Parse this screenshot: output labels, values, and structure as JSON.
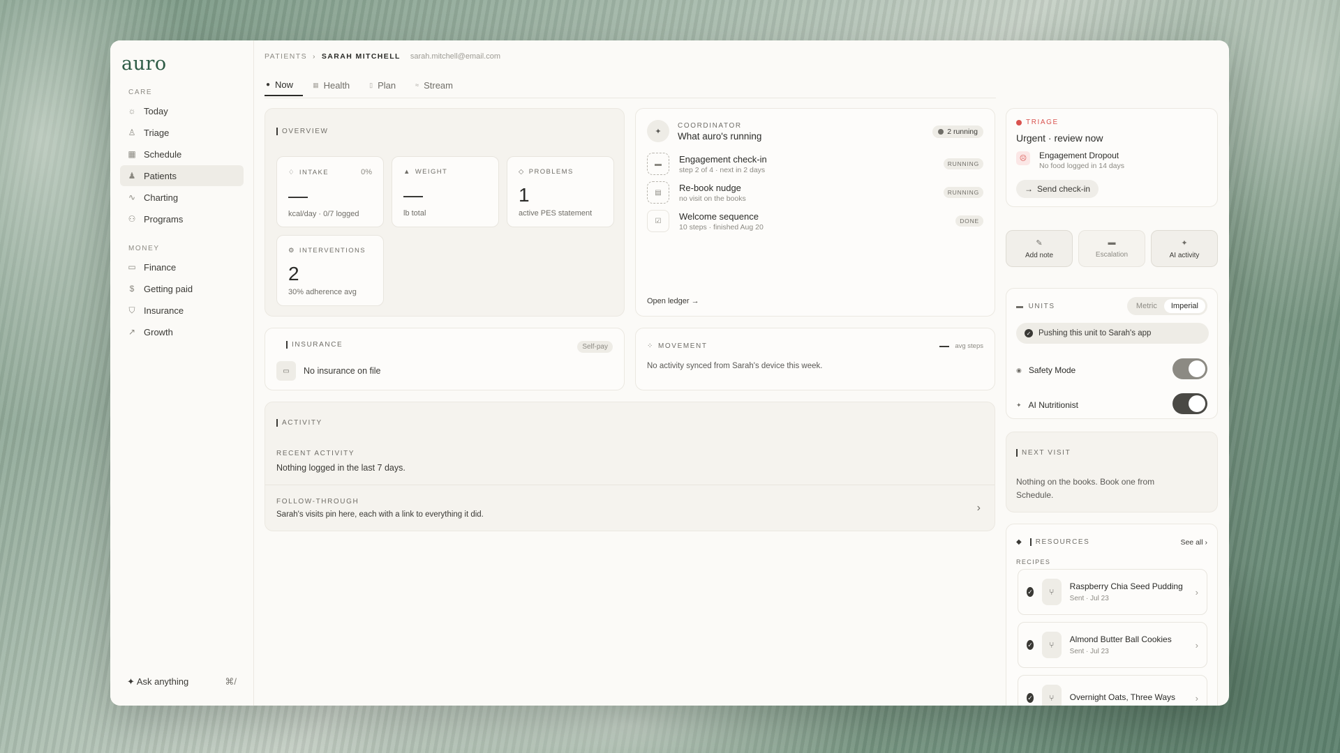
{
  "app": {
    "logo": "auro"
  },
  "sidebar": {
    "care_heading": "CARE",
    "care_items": [
      {
        "label": "Today",
        "icon": "sun-icon"
      },
      {
        "label": "Triage",
        "icon": "triage-icon"
      },
      {
        "label": "Schedule",
        "icon": "calendar-icon"
      },
      {
        "label": "Patients",
        "icon": "patients-icon",
        "active": true
      },
      {
        "label": "Charting",
        "icon": "pulse-icon"
      },
      {
        "label": "Programs",
        "icon": "programs-icon"
      }
    ],
    "money_heading": "MONEY",
    "money_items": [
      {
        "label": "Finance",
        "icon": "finance-icon"
      },
      {
        "label": "Getting paid",
        "icon": "dollar-icon"
      },
      {
        "label": "Insurance",
        "icon": "shield-icon"
      },
      {
        "label": "Growth",
        "icon": "trend-icon"
      }
    ],
    "ask_label": "Ask anything",
    "ask_shortcut": "⌘/"
  },
  "breadcrumb": {
    "root": "PATIENTS",
    "separator": "›",
    "current": "SARAH MITCHELL",
    "email": "sarah.mitchell@email.com"
  },
  "tabs": [
    {
      "label": "Now",
      "active": true
    },
    {
      "label": "Health"
    },
    {
      "label": "Plan"
    },
    {
      "label": "Stream"
    }
  ],
  "overview": {
    "title": "OVERVIEW",
    "intake": {
      "label": "INTAKE",
      "pct": "0%",
      "value": "—",
      "sub": "kcal/day · 0/7 logged"
    },
    "weight": {
      "label": "WEIGHT",
      "value": "—",
      "sub": "lb total"
    },
    "problems": {
      "label": "PROBLEMS",
      "value": "1",
      "sub": "active PES statement"
    },
    "interventions": {
      "label": "INTERVENTIONS",
      "value": "2",
      "sub": "30% adherence avg"
    }
  },
  "coordinator": {
    "label": "COORDINATOR",
    "title": "What auro's running",
    "badge": "2 running",
    "items": [
      {
        "name": "Engagement check-in",
        "sub": "step 2 of 4 · next in 2 days",
        "status": "RUNNING"
      },
      {
        "name": "Re-book nudge",
        "sub": "no visit on the books",
        "status": "RUNNING"
      },
      {
        "name": "Welcome sequence",
        "sub": "10 steps · finished Aug 20",
        "status": "DONE"
      }
    ],
    "link": "Open ledger →"
  },
  "triage": {
    "label": "TRIAGE",
    "title": "Urgent · review now",
    "alert_title": "Engagement Dropout",
    "alert_sub": "No food logged in 14 days",
    "button": "Send check-in",
    "accent": "#d9534f"
  },
  "actions": [
    {
      "label": "Add note",
      "icon": "note-icon"
    },
    {
      "label": "Escalation",
      "icon": "escalation-icon"
    },
    {
      "label": "AI activity",
      "icon": "sparkle-icon"
    }
  ],
  "units": {
    "title": "UNITS",
    "options": [
      "Metric",
      "Imperial"
    ],
    "selected": "Imperial",
    "notice": "Pushing this unit to Sarah's app",
    "safety_label": "Safety Mode",
    "ai_label": "AI Nutritionist"
  },
  "insurance": {
    "title": "INSURANCE",
    "badge": "Self-pay",
    "text": "No insurance on file"
  },
  "movement": {
    "title": "MOVEMENT",
    "legend": "avg steps",
    "text": "No activity synced from Sarah's device this week."
  },
  "activity": {
    "title": "ACTIVITY",
    "recent_label": "RECENT ACTIVITY",
    "recent_text": "Nothing logged in the last 7 days.",
    "follow_label": "FOLLOW-THROUGH",
    "follow_text": "Sarah's visits pin here, each with a link to everything it did."
  },
  "next_visit": {
    "title": "NEXT VISIT",
    "text": "Nothing on the books. Book one from Schedule."
  },
  "resources": {
    "title": "RESOURCES",
    "see_all": "See all",
    "category": "RECIPES",
    "items": [
      {
        "title": "Raspberry Chia Seed Pudding",
        "sub": "Sent · Jul 23"
      },
      {
        "title": "Almond Butter Ball Cookies",
        "sub": "Sent · Jul 23"
      },
      {
        "title": "Overnight Oats, Three Ways",
        "sub": ""
      }
    ]
  }
}
